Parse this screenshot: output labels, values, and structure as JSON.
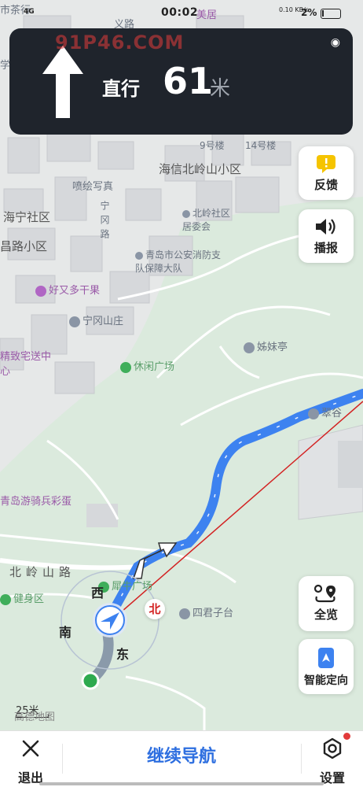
{
  "status_bar": {
    "time": "00:02",
    "carrier_left": "4G",
    "network_speed": "0.10 KB/s",
    "battery": "2%"
  },
  "watermark": {
    "top": "91P46.COM"
  },
  "guidance": {
    "action": "直行",
    "distance": "61",
    "unit": "米"
  },
  "side_buttons": {
    "feedback": "反馈",
    "broadcast": "播报",
    "overview": "全览",
    "smart_locate": "智能定向"
  },
  "compass": {
    "west": "西",
    "south": "南",
    "east": "东",
    "north": "北"
  },
  "map_labels": {
    "l1": "市茶行",
    "l2": "义路",
    "l3": "美居",
    "l4": "学",
    "l5": "海信北岭山小区",
    "l6": "9号楼",
    "l7": "14号楼",
    "l8": "喷绘写真",
    "l9": "海宁社区",
    "l10": "北岭社区居委会",
    "l11": "昌路小区",
    "l12": "青岛市公安消防支队保障大队",
    "l13": "好又多干果",
    "l14": "宁冈山庄",
    "l15": "姊妹亭",
    "l16": "休闲广场",
    "l17": "精致宅送中心",
    "l18": "青岛游骑兵彩蛋",
    "l19": "翠谷",
    "l20": "北岭山路",
    "l21": "健身区",
    "l22": "犀牛广场",
    "l23": "四君子台",
    "l24": "宁冈路"
  },
  "scale": {
    "label": "25米",
    "logo": "高德地图"
  },
  "bottom_bar": {
    "exit": "退出",
    "continue": "继续导航",
    "settings": "设置"
  },
  "colors": {
    "route": "#3d82f0",
    "route_done": "#8a9aaa",
    "card_bg": "#1f242c",
    "accent_blue": "#2e6fe0",
    "feedback_yellow": "#f5c400"
  }
}
